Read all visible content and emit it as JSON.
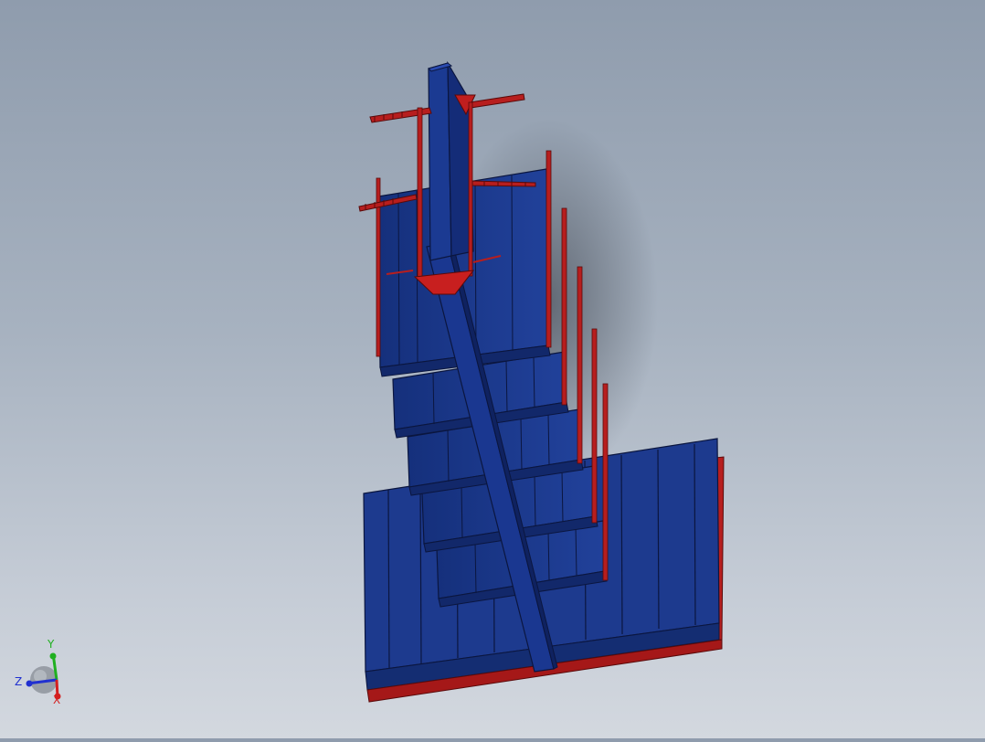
{
  "viewport": {
    "model": "stair-tower-assembly",
    "colors": {
      "background_top": "#8f9cad",
      "background_bottom": "#d3d8df",
      "panel_blue": "#1c3a8c",
      "panel_blue_dark": "#12286a",
      "panel_edge": "#0b163f",
      "frame_red": "#b71e1e",
      "frame_red_dark": "#7a1010"
    }
  },
  "triad": {
    "x_label": "X",
    "y_label": "Y",
    "z_label": "Z",
    "x_color": "#d42020",
    "y_color": "#20b020",
    "z_color": "#2030d0"
  }
}
